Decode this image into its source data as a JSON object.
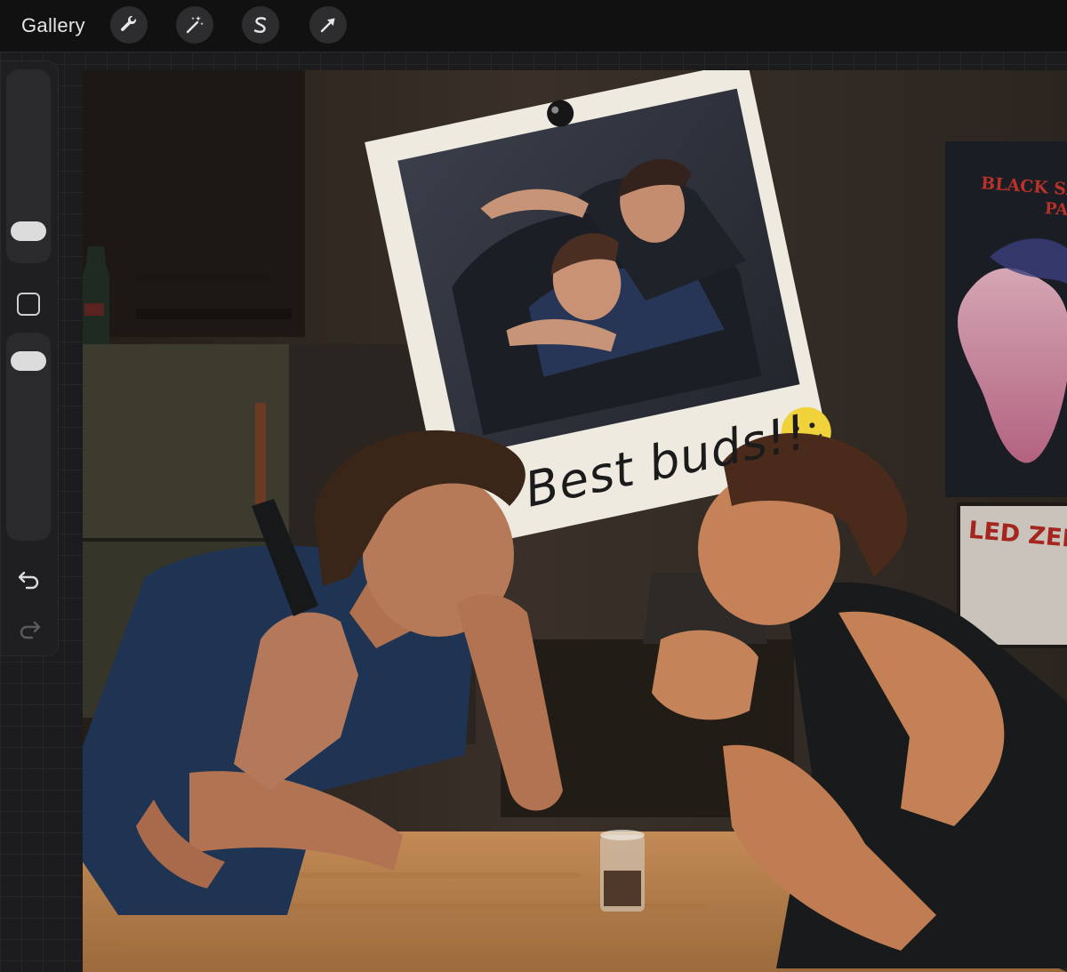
{
  "topbar": {
    "gallery_label": "Gallery",
    "tools": [
      {
        "name": "wrench-icon"
      },
      {
        "name": "magic-wand-icon"
      },
      {
        "name": "selection-s-icon"
      },
      {
        "name": "move-arrow-icon"
      }
    ]
  },
  "sidebar": {
    "icons": [
      "brush-size-slider",
      "modify-square-icon",
      "opacity-slider",
      "undo-icon",
      "redo-icon"
    ]
  },
  "artwork": {
    "polaroid_caption": "Best buds!!",
    "poster_top_line1": "BLACK SA",
    "poster_top_line2": "PA",
    "poster_bottom": "LED ZEPP"
  },
  "colors": {
    "ui_bg": "#1c1c1e",
    "topbar_bg": "#111112",
    "accent_blue_shirt": "#1f3452",
    "table_wood": "#b07b49"
  }
}
